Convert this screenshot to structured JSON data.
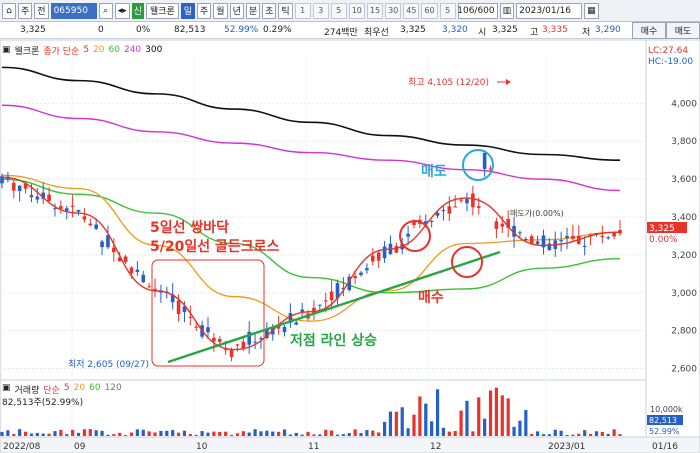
{
  "toolbar": {
    "menu1": "주",
    "menu2": "전",
    "code": "065950",
    "name": "웰크론",
    "badge": "신",
    "periods": [
      "일",
      "주",
      "월",
      "년",
      "분",
      "초",
      "틱"
    ],
    "nums": [
      "1",
      "3",
      "5",
      "10",
      "15",
      "30",
      "45",
      "60",
      "5"
    ],
    "count": "106/600",
    "date": "2023/01/16"
  },
  "quote": {
    "price": "3,325",
    "change": "0",
    "change_pct": "0%",
    "volume": "82,513",
    "vol_ratio": "52.99%",
    "turnover_pct": "0.29%",
    "amount": "274백만",
    "best_bid_label": "최우선",
    "bid1": "3,325",
    "bid2": "3,320",
    "open_label": "시",
    "open": "3,325",
    "high_label": "고",
    "high": "3,335",
    "low_label": "저",
    "low": "3,290",
    "sell_btn": "매수",
    "buy_btn": "매도"
  },
  "legend": {
    "name": "웰크론",
    "ma_label": "종가 단순",
    "ma5": "5",
    "ma20": "20",
    "ma60": "60",
    "ma240": "240",
    "ma300": "300"
  },
  "side_labels": {
    "lc": "LC:27.64",
    "hc": "HC:-19.00",
    "current_price": "3,325",
    "current_pct": "0.00%",
    "vol_badge1": "82,513",
    "vol_badge2": "52.99%",
    "vol_10k": "10,000k"
  },
  "annotations": {
    "high_label": "최고 4,105 (12/20)",
    "low_label": "최저 2,605 (09/27)",
    "text1": "5일선 쌍바닥",
    "text2": "5/20일선 골든크로스",
    "text3": "저점 라인 상승",
    "sell": "매도",
    "buy": "매수",
    "marker": "매도가(0.00%)"
  },
  "volume_legend": {
    "label": "거래량",
    "ma_label": "단순",
    "v5": "5",
    "v20": "20",
    "v60": "60",
    "v120": "120",
    "info": "82,513주(52.99%)"
  },
  "colors": {
    "up": "#e8332a",
    "down": "#2360c9",
    "ma5": "#e8332a",
    "ma20": "#f09a1a",
    "ma60": "#38c238",
    "ma240": "#d232d6",
    "ma300": "#111111",
    "trend": "#27a645"
  },
  "chart_data": {
    "type": "candlestick",
    "y_axis_ticks": [
      2600,
      2800,
      3000,
      3200,
      3400,
      3600,
      3800,
      4000
    ],
    "ylim": [
      2550,
      4250
    ],
    "x_axis_labels": [
      "2022/08",
      "09",
      "10",
      "11",
      "12",
      "2023/01",
      "01/16"
    ],
    "high": 4105,
    "low": 2605,
    "last": 3325,
    "series": [
      {
        "name": "300",
        "values": [
          4190,
          4120,
          4050,
          3970,
          3900,
          3830,
          3780,
          3730,
          3700
        ]
      },
      {
        "name": "240",
        "values": [
          3990,
          3920,
          3850,
          3790,
          3740,
          3700,
          3650,
          3600,
          3540
        ]
      },
      {
        "name": "60",
        "values": [
          3600,
          3520,
          3420,
          3260,
          3080,
          3000,
          3020,
          3130,
          3180
        ]
      },
      {
        "name": "20",
        "values": [
          3620,
          3550,
          3250,
          2980,
          2850,
          3010,
          3260,
          3280,
          3320
        ]
      },
      {
        "name": "5",
        "values": [
          3610,
          3420,
          3010,
          2700,
          2900,
          3230,
          3500,
          3250,
          3320
        ]
      }
    ],
    "volume_ticks": [
      "10,000k"
    ]
  }
}
